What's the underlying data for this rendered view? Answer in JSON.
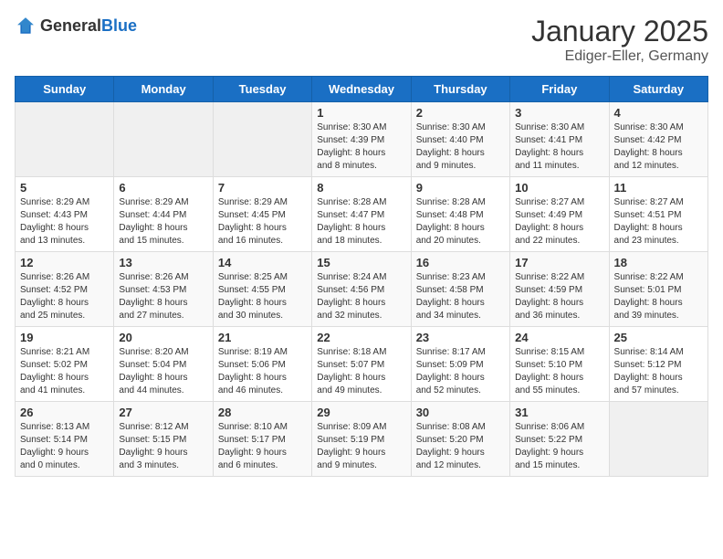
{
  "header": {
    "logo_general": "General",
    "logo_blue": "Blue",
    "month": "January 2025",
    "location": "Ediger-Eller, Germany"
  },
  "weekdays": [
    "Sunday",
    "Monday",
    "Tuesday",
    "Wednesday",
    "Thursday",
    "Friday",
    "Saturday"
  ],
  "weeks": [
    [
      {
        "day": "",
        "info": ""
      },
      {
        "day": "",
        "info": ""
      },
      {
        "day": "",
        "info": ""
      },
      {
        "day": "1",
        "info": "Sunrise: 8:30 AM\nSunset: 4:39 PM\nDaylight: 8 hours\nand 8 minutes."
      },
      {
        "day": "2",
        "info": "Sunrise: 8:30 AM\nSunset: 4:40 PM\nDaylight: 8 hours\nand 9 minutes."
      },
      {
        "day": "3",
        "info": "Sunrise: 8:30 AM\nSunset: 4:41 PM\nDaylight: 8 hours\nand 11 minutes."
      },
      {
        "day": "4",
        "info": "Sunrise: 8:30 AM\nSunset: 4:42 PM\nDaylight: 8 hours\nand 12 minutes."
      }
    ],
    [
      {
        "day": "5",
        "info": "Sunrise: 8:29 AM\nSunset: 4:43 PM\nDaylight: 8 hours\nand 13 minutes."
      },
      {
        "day": "6",
        "info": "Sunrise: 8:29 AM\nSunset: 4:44 PM\nDaylight: 8 hours\nand 15 minutes."
      },
      {
        "day": "7",
        "info": "Sunrise: 8:29 AM\nSunset: 4:45 PM\nDaylight: 8 hours\nand 16 minutes."
      },
      {
        "day": "8",
        "info": "Sunrise: 8:28 AM\nSunset: 4:47 PM\nDaylight: 8 hours\nand 18 minutes."
      },
      {
        "day": "9",
        "info": "Sunrise: 8:28 AM\nSunset: 4:48 PM\nDaylight: 8 hours\nand 20 minutes."
      },
      {
        "day": "10",
        "info": "Sunrise: 8:27 AM\nSunset: 4:49 PM\nDaylight: 8 hours\nand 22 minutes."
      },
      {
        "day": "11",
        "info": "Sunrise: 8:27 AM\nSunset: 4:51 PM\nDaylight: 8 hours\nand 23 minutes."
      }
    ],
    [
      {
        "day": "12",
        "info": "Sunrise: 8:26 AM\nSunset: 4:52 PM\nDaylight: 8 hours\nand 25 minutes."
      },
      {
        "day": "13",
        "info": "Sunrise: 8:26 AM\nSunset: 4:53 PM\nDaylight: 8 hours\nand 27 minutes."
      },
      {
        "day": "14",
        "info": "Sunrise: 8:25 AM\nSunset: 4:55 PM\nDaylight: 8 hours\nand 30 minutes."
      },
      {
        "day": "15",
        "info": "Sunrise: 8:24 AM\nSunset: 4:56 PM\nDaylight: 8 hours\nand 32 minutes."
      },
      {
        "day": "16",
        "info": "Sunrise: 8:23 AM\nSunset: 4:58 PM\nDaylight: 8 hours\nand 34 minutes."
      },
      {
        "day": "17",
        "info": "Sunrise: 8:22 AM\nSunset: 4:59 PM\nDaylight: 8 hours\nand 36 minutes."
      },
      {
        "day": "18",
        "info": "Sunrise: 8:22 AM\nSunset: 5:01 PM\nDaylight: 8 hours\nand 39 minutes."
      }
    ],
    [
      {
        "day": "19",
        "info": "Sunrise: 8:21 AM\nSunset: 5:02 PM\nDaylight: 8 hours\nand 41 minutes."
      },
      {
        "day": "20",
        "info": "Sunrise: 8:20 AM\nSunset: 5:04 PM\nDaylight: 8 hours\nand 44 minutes."
      },
      {
        "day": "21",
        "info": "Sunrise: 8:19 AM\nSunset: 5:06 PM\nDaylight: 8 hours\nand 46 minutes."
      },
      {
        "day": "22",
        "info": "Sunrise: 8:18 AM\nSunset: 5:07 PM\nDaylight: 8 hours\nand 49 minutes."
      },
      {
        "day": "23",
        "info": "Sunrise: 8:17 AM\nSunset: 5:09 PM\nDaylight: 8 hours\nand 52 minutes."
      },
      {
        "day": "24",
        "info": "Sunrise: 8:15 AM\nSunset: 5:10 PM\nDaylight: 8 hours\nand 55 minutes."
      },
      {
        "day": "25",
        "info": "Sunrise: 8:14 AM\nSunset: 5:12 PM\nDaylight: 8 hours\nand 57 minutes."
      }
    ],
    [
      {
        "day": "26",
        "info": "Sunrise: 8:13 AM\nSunset: 5:14 PM\nDaylight: 9 hours\nand 0 minutes."
      },
      {
        "day": "27",
        "info": "Sunrise: 8:12 AM\nSunset: 5:15 PM\nDaylight: 9 hours\nand 3 minutes."
      },
      {
        "day": "28",
        "info": "Sunrise: 8:10 AM\nSunset: 5:17 PM\nDaylight: 9 hours\nand 6 minutes."
      },
      {
        "day": "29",
        "info": "Sunrise: 8:09 AM\nSunset: 5:19 PM\nDaylight: 9 hours\nand 9 minutes."
      },
      {
        "day": "30",
        "info": "Sunrise: 8:08 AM\nSunset: 5:20 PM\nDaylight: 9 hours\nand 12 minutes."
      },
      {
        "day": "31",
        "info": "Sunrise: 8:06 AM\nSunset: 5:22 PM\nDaylight: 9 hours\nand 15 minutes."
      },
      {
        "day": "",
        "info": ""
      }
    ]
  ]
}
